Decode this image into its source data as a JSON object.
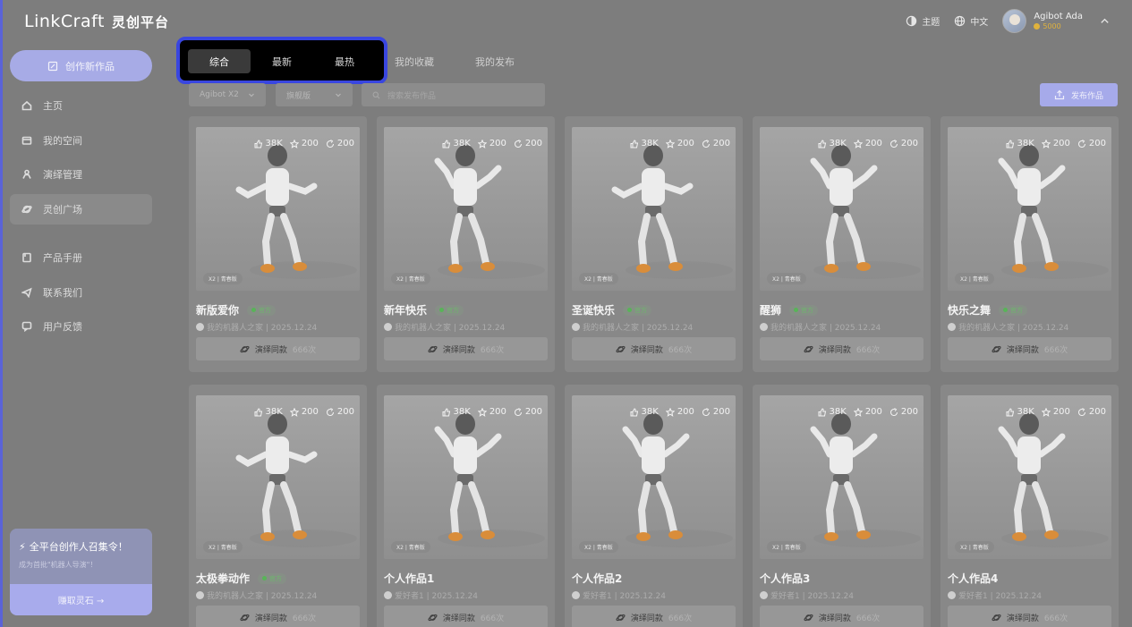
{
  "brand": {
    "name": "LinkCraft",
    "name_cn": "灵创平台"
  },
  "topbar": {
    "theme_label": "主题",
    "lang_label": "中文",
    "user_name": "Agibot Ada",
    "coins": "5000"
  },
  "sidebar": {
    "create_label": "创作新作品",
    "items": [
      {
        "label": "主页",
        "icon": "home-icon"
      },
      {
        "label": "我的空间",
        "icon": "folder-icon"
      },
      {
        "label": "演绎管理",
        "icon": "robot-icon"
      },
      {
        "label": "灵创广场",
        "icon": "planet-icon",
        "active": true
      },
      {
        "label": "产品手册",
        "icon": "book-icon"
      },
      {
        "label": "联系我们",
        "icon": "send-icon"
      },
      {
        "label": "用户反馈",
        "icon": "feedback-icon"
      }
    ],
    "promo": {
      "title": "全平台创作人召集令！",
      "subtitle": "成为首批\"机器人导演\"！",
      "button": "赚取灵石 →"
    }
  },
  "tabs": [
    "综合",
    "最新",
    "最热"
  ],
  "other_tabs": [
    "我的收藏",
    "我的发布"
  ],
  "filters": {
    "model": "Agibot X2",
    "version": "旗舰版",
    "search_placeholder": "搜索发布作品",
    "publish_label": "发布作品"
  },
  "cards": [
    {
      "title": "新版爱你",
      "official": "官方",
      "author": "我的机器人之家 | 2025.12.24",
      "likes": "38K",
      "stars": "200",
      "shares": "200",
      "tag": "X2 | 青春版",
      "replay": "演绎同款",
      "count": "666次"
    },
    {
      "title": "新年快乐",
      "official": "官方",
      "author": "我的机器人之家 | 2025.12.24",
      "likes": "38K",
      "stars": "200",
      "shares": "200",
      "tag": "X2 | 青春版",
      "replay": "演绎同款",
      "count": "666次"
    },
    {
      "title": "圣诞快乐",
      "official": "官方",
      "author": "我的机器人之家 | 2025.12.24",
      "likes": "38K",
      "stars": "200",
      "shares": "200",
      "tag": "X2 | 青春版",
      "replay": "演绎同款",
      "count": "666次"
    },
    {
      "title": "醒狮",
      "official": "官方",
      "author": "我的机器人之家 | 2025.12.24",
      "likes": "38K",
      "stars": "200",
      "shares": "200",
      "tag": "X2 | 青春版",
      "replay": "演绎同款",
      "count": "666次"
    },
    {
      "title": "快乐之舞",
      "official": "官方",
      "author": "我的机器人之家 | 2025.12.24",
      "likes": "38K",
      "stars": "200",
      "shares": "200",
      "tag": "X2 | 青春版",
      "replay": "演绎同款",
      "count": "666次"
    },
    {
      "title": "太极拳动作",
      "official": "官方",
      "author": "我的机器人之家 | 2025.12.24",
      "likes": "38K",
      "stars": "200",
      "shares": "200",
      "tag": "X2 | 青春版",
      "replay": "演绎同款",
      "count": "666次"
    },
    {
      "title": "个人作品1",
      "official": "",
      "author": "爱好者1 | 2025.12.24",
      "likes": "38K",
      "stars": "200",
      "shares": "200",
      "tag": "X2 | 青春版",
      "replay": "演绎同款",
      "count": "666次"
    },
    {
      "title": "个人作品2",
      "official": "",
      "author": "爱好者1 | 2025.12.24",
      "likes": "38K",
      "stars": "200",
      "shares": "200",
      "tag": "X2 | 青春版",
      "replay": "演绎同款",
      "count": "666次"
    },
    {
      "title": "个人作品3",
      "official": "",
      "author": "爱好者1 | 2025.12.24",
      "likes": "38K",
      "stars": "200",
      "shares": "200",
      "tag": "X2 | 青春版",
      "replay": "演绎同款",
      "count": "666次"
    },
    {
      "title": "个人作品4",
      "official": "",
      "author": "爱好者1 | 2025.12.24",
      "likes": "38K",
      "stars": "200",
      "shares": "200",
      "tag": "X2 | 青春版",
      "replay": "演绎同款",
      "count": "666次"
    }
  ]
}
